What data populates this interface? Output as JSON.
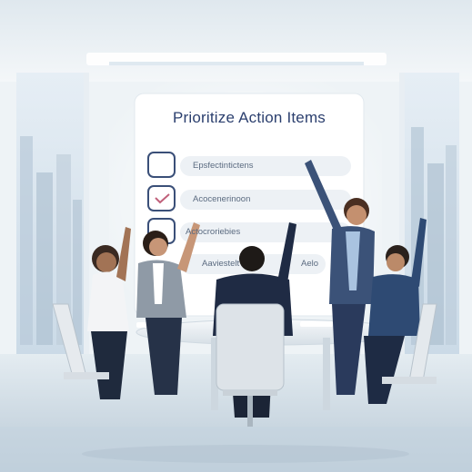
{
  "screen": {
    "title": "Prioritize Action Items",
    "items": [
      {
        "label": "Epsfectintictens",
        "checked": false
      },
      {
        "label": "Acocenerinoon",
        "checked": true
      },
      {
        "label": "Actocroriebies",
        "checked": false
      },
      {
        "label": "Aaviestelt",
        "checked": false
      }
    ],
    "trailing_text": "Aelo"
  },
  "colors": {
    "title": "#2b3f6e",
    "checkbox_border": "#3a4f78",
    "check_mark": "#c0607a",
    "suit_navy": "#2a3a5c",
    "window_sky": "#d7e6f2"
  }
}
